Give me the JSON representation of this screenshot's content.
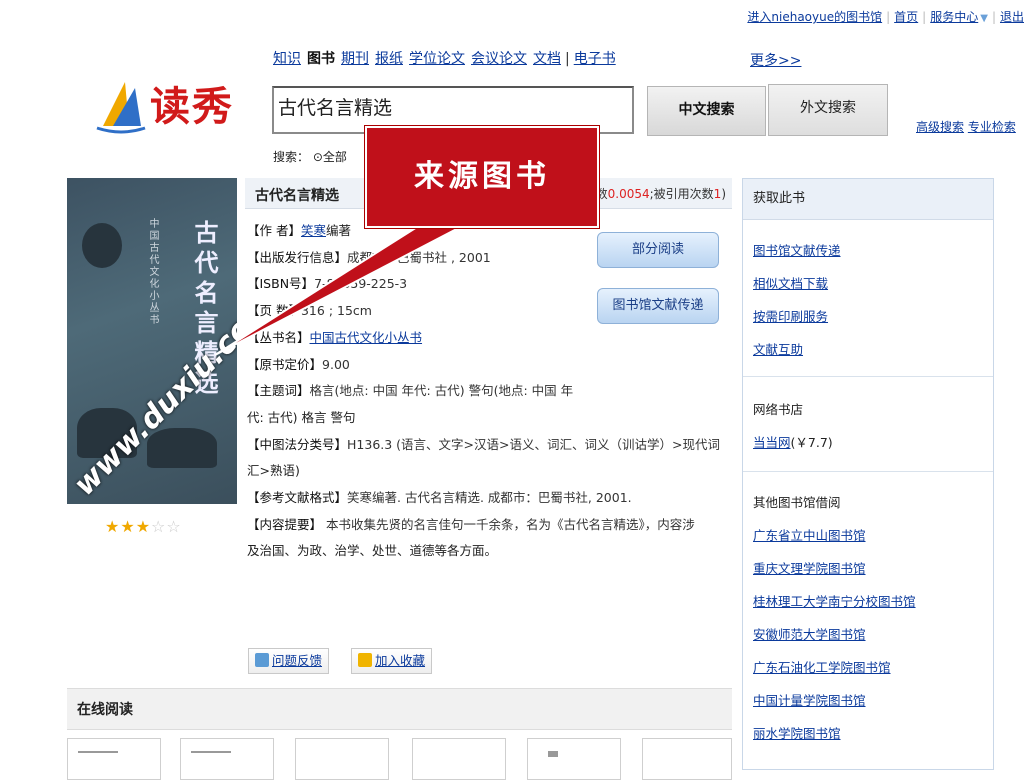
{
  "topbar": {
    "enter_lib": "进入niehaoyue的图书馆",
    "home": "首页",
    "service": "服务中心",
    "logout": "退出"
  },
  "logo": {
    "text": "读秀",
    "icon": "sailboat-logo-icon"
  },
  "nav": {
    "items": [
      "知识",
      "图书",
      "期刊",
      "报纸",
      "学位论文",
      "会议论文",
      "文档",
      "电子书"
    ],
    "active": "图书",
    "more": "更多>>"
  },
  "search": {
    "value": "古代名言精选",
    "cn_button": "中文搜索",
    "foreign_button": "外文搜索",
    "advanced": "高级搜索",
    "pro": "专业检索",
    "scope_label": "搜索：",
    "scope_option": "全部"
  },
  "callout": {
    "text": "来源图书"
  },
  "cover": {
    "title": "古代名言精选",
    "series": "中国古代文化小丛书",
    "watermark": "www.duxiu.com",
    "rating_stars": 3,
    "max_stars": 5
  },
  "book": {
    "title": "古代名言精选",
    "cite_prefix": "数",
    "cite_value": "0.0054",
    "cite_mid": ";被引用次数",
    "cite_count": "1",
    "cite_suffix": ")",
    "author_label": "【作 者】",
    "author": "笑寒",
    "author_suffix": "编著",
    "pub_label": "【出版发行信息】",
    "pub": "成都市：巴蜀书社 , 2001",
    "isbn_label": "【ISBN号】",
    "isbn": "7-80659-225-3",
    "pages_label": "【页 数】",
    "pages": "316 ; 15cm",
    "series_label": "【丛书名】",
    "series": "中国古代文化小丛书",
    "price_label": "【原书定价】",
    "price": "9.00",
    "subject_label": "【主题词】",
    "subject_1": "格言(地点: 中国 年代: 古代) 警句(地点: 中国 年",
    "subject_2": "代: 古代) 格言 警句",
    "clc_label": "【中图法分类号】",
    "clc_1": "H136.3 (语言、文字>汉语>语义、词汇、词义（训诂学）>现代词",
    "clc_2": "汇>熟语)",
    "ref_label": "【参考文献格式】",
    "ref": "笑寒编著. 古代名言精选. 成都市：巴蜀书社, 2001.",
    "summary_label": "【内容提要】",
    "summary_1": "本书收集先贤的名言佳句一千余条，名为《古代名言精选》，内容涉",
    "summary_2": "及治国、为政、治学、处世、道德等各方面。",
    "btn_partial": "部分阅读",
    "btn_ill": "图书馆文献传递",
    "feedback": "问题反馈",
    "favorite": "加入收藏"
  },
  "sidebar": {
    "header": "获取此书",
    "get_links": [
      "图书馆文献传递",
      "相似文档下载",
      "按需印刷服务",
      "文献互助"
    ],
    "bookstore_head": "网络书店",
    "bookstore_link": "当当网",
    "bookstore_price": "(￥7.7)",
    "libs_head": "其他图书馆借阅",
    "libs": [
      "广东省立中山图书馆",
      "重庆文理学院图书馆",
      "桂林理工大学南宁分校图书馆",
      "安徽师范大学图书馆",
      "广东石油化工学院图书馆",
      "中国计量学院图书馆",
      "丽水学院图书馆"
    ]
  },
  "online": {
    "title": "在线阅读"
  },
  "colors": {
    "brand_red": "#c0101a",
    "link_blue": "#0b3a9c",
    "cite_red": "#d22"
  }
}
